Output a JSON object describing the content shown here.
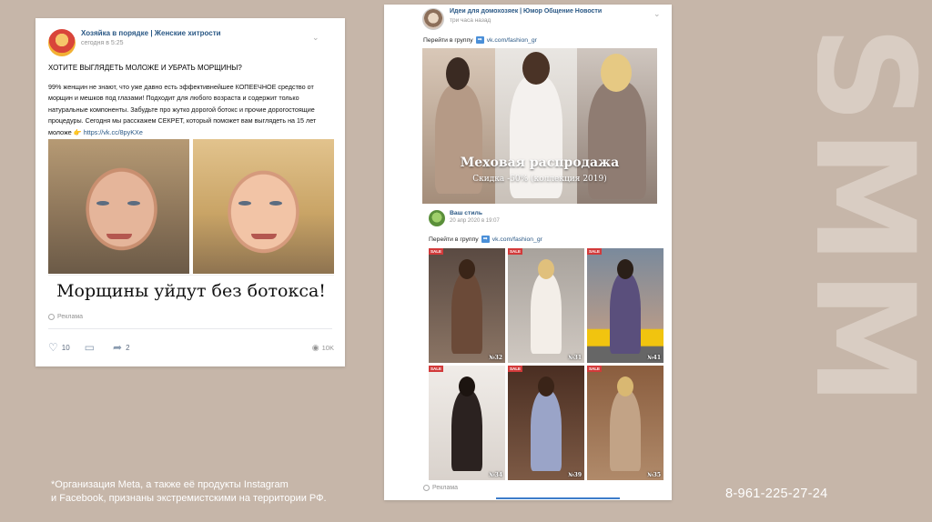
{
  "watermark": "SMM",
  "left_post": {
    "group_name": "Хозяйка в порядке | Женские хитрости",
    "time": "сегодня в 5:25",
    "headline": "ХОТИТЕ ВЫГЛЯДЕТЬ МОЛОЖЕ И УБРАТЬ МОРЩИНЫ?",
    "body": "99% женщин не знают, что уже давно есть эффективнейшее КОПЕЕЧНОЕ средство от морщин и мешков под глазами! Подходит для любого возраста и содержит только натуральные компоненты. Забудьте про жутко дорогой ботокс и прочие дорогостоящие процедуры. Сегодня мы расскажем СЕКРЕТ, который поможет вам выглядеть на 15 лет моложе 👉",
    "link": "https://vk.cc/8pyKXe",
    "image_caption": "Морщины уйдут без ботокса!",
    "ad_label": "Реклама",
    "likes": "10",
    "shares": "2",
    "views": "10K"
  },
  "right_post": {
    "group_name": "Идеи для домохозяек | Юмор Общение Новости",
    "time": "три часа назад",
    "goto_text": "Перейти в группу",
    "goto_link": "vk.com/fashion_gr",
    "banner_title": "Меховая распродажа",
    "banner_sub": "Скидка -50% (коллекция 2019)",
    "inner_group_name": "Ваш стиль",
    "inner_time": "20 апр 2020 в 19:07",
    "inner_goto_text": "Перейти в группу",
    "inner_goto_link": "vk.com/fashion_gr",
    "tiles": [
      {
        "num": "№32"
      },
      {
        "num": "№31"
      },
      {
        "num": "№41"
      },
      {
        "num": "№34"
      },
      {
        "num": "№39"
      },
      {
        "num": "№35"
      }
    ],
    "ad_label": "Реклама"
  },
  "footnote_line1": "*Организация Meta, а также её продукты Instagram",
  "footnote_line2": "и Facebook, признаны экстремистскими на территории РФ.",
  "phone": "8-961-225-27-24",
  "icons": {
    "like": "heart-icon",
    "comment": "comment-icon",
    "share": "share-icon",
    "views": "eye-icon",
    "ad": "ad-icon",
    "goto": "arrow-right-icon"
  }
}
